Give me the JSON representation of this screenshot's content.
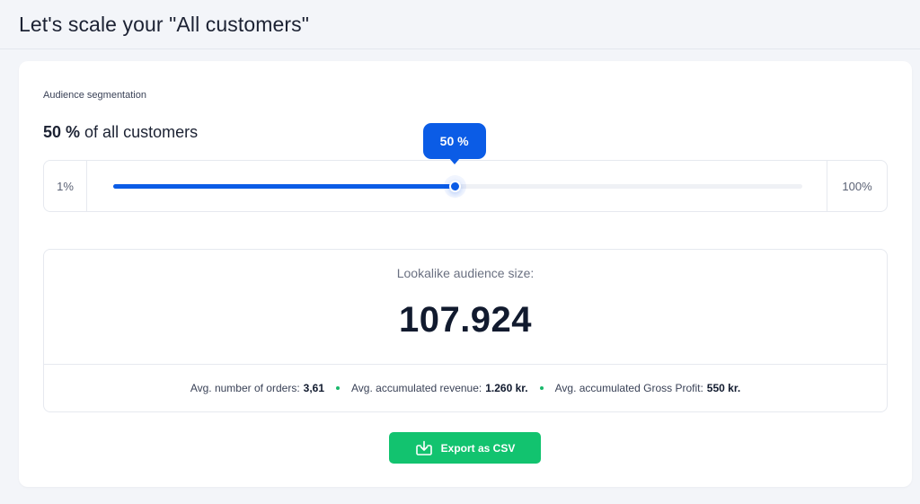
{
  "header": {
    "title": "Let's scale your \"All customers\""
  },
  "segmentation": {
    "label": "Audience segmentation",
    "headline_value": "50 %",
    "headline_suffix": "of all customers",
    "slider": {
      "min_label": "1%",
      "max_label": "100%",
      "tooltip": "50 %",
      "percent": 50,
      "accent_color": "#0b5ce6"
    }
  },
  "lookalike": {
    "label": "Lookalike audience size:",
    "value": "107.924",
    "stats": [
      {
        "label": "Avg. number of orders:",
        "value": "3,61"
      },
      {
        "label": "Avg. accumulated revenue:",
        "value": "1.260 kr."
      },
      {
        "label": "Avg. accumulated Gross Profit:",
        "value": "550 kr."
      }
    ],
    "separator_color": "#19b86b"
  },
  "export": {
    "label": "Export as CSV",
    "icon": "download-icon",
    "color": "#12c36f"
  }
}
